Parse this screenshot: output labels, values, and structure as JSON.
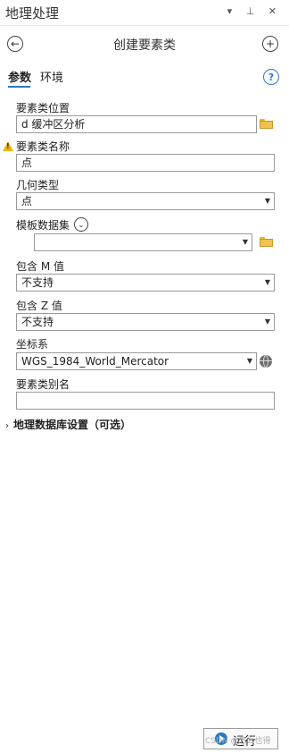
{
  "pane": {
    "title": "地理处理",
    "controls": "▾ ⊥ ✕"
  },
  "tool": {
    "title": "创建要素类",
    "back_icon": "back-arrow-icon",
    "add_icon": "plus-icon"
  },
  "tabs": [
    {
      "label": "参数",
      "active": true
    },
    {
      "label": "环境",
      "active": false
    }
  ],
  "help_icon": "?",
  "params": {
    "location": {
      "label": "要素类位置",
      "value": "d 缓冲区分析"
    },
    "name": {
      "label": "要素类名称",
      "value": "点",
      "warning": true
    },
    "geometry": {
      "label": "几何类型",
      "value": "点"
    },
    "template": {
      "label": "模板数据集",
      "value": ""
    },
    "has_m": {
      "label": "包含 M 值",
      "value": "不支持"
    },
    "has_z": {
      "label": "包含 Z 值",
      "value": "不支持"
    },
    "crs": {
      "label": "坐标系",
      "value": "WGS_1984_World_Mercator"
    },
    "alias": {
      "label": "要素类别名",
      "value": ""
    }
  },
  "section": {
    "label": "地理数据库设置（可选）"
  },
  "run": {
    "label": "运行"
  },
  "watermark": "CSDN @怎么也得",
  "colors": {
    "accent": "#2b79c2",
    "folder": "#f2c14e",
    "warning": "#f0b400"
  }
}
